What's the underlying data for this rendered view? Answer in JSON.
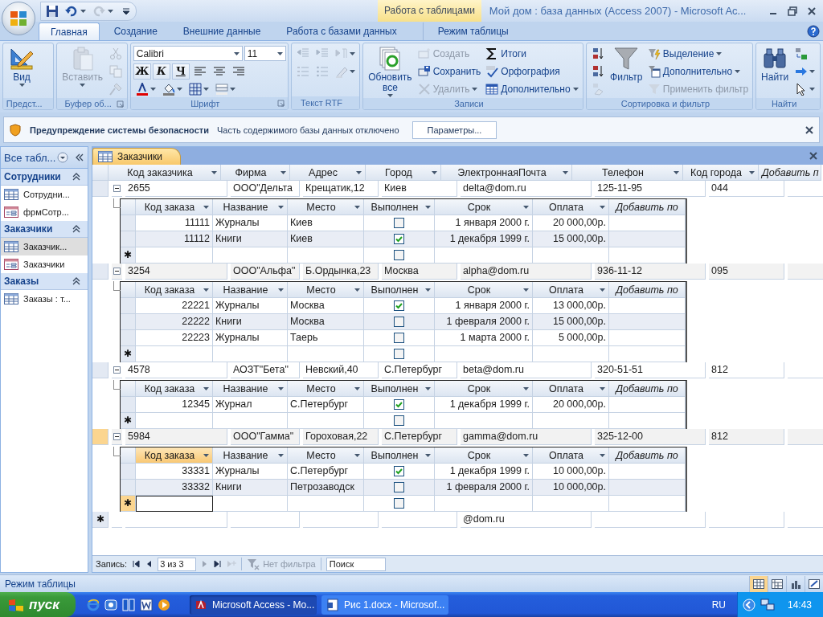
{
  "window": {
    "title": "Мой дом : база данных (Access 2007) - Microsoft Ac...",
    "context_label": "Работа с таблицами"
  },
  "quick_access": [
    {
      "kind": "save",
      "disabled": false
    },
    {
      "kind": "undo",
      "disabled": false
    },
    {
      "kind": "redo",
      "disabled": true
    }
  ],
  "ribbon_tabs": [
    {
      "label": "Главная",
      "selected": true,
      "kind": "main"
    },
    {
      "label": "Создание",
      "selected": false,
      "kind": "main"
    },
    {
      "label": "Внешние данные",
      "selected": false,
      "kind": "main"
    },
    {
      "label": "Работа с базами данных",
      "selected": false,
      "kind": "main"
    },
    {
      "label": "Режим таблицы",
      "selected": false,
      "kind": "context"
    }
  ],
  "ribbon_groups": [
    {
      "label": "Предст...",
      "launcher": false,
      "parts": [
        {
          "kind": "large",
          "label": "Вид",
          "caret": true,
          "disabled": false
        }
      ]
    },
    {
      "label": "Буфер об...",
      "launcher": true,
      "parts": [
        {
          "kind": "large",
          "label": "Вставить",
          "caret": true,
          "disabled": true
        },
        {
          "kind": "stack",
          "items": [
            {
              "kind": "icon",
              "disabled": true
            },
            {
              "kind": "icon",
              "disabled": true
            },
            {
              "kind": "icon",
              "disabled": true
            }
          ]
        }
      ]
    },
    {
      "label": "Шрифт",
      "launcher": true,
      "parts": [
        {
          "kind": "lines",
          "lines": [
            {
              "items": [
                {
                  "kind": "field",
                  "label": "Calibri",
                  "wide": true
                },
                {
                  "kind": "field",
                  "label": "11",
                  "wide": false
                }
              ]
            },
            {
              "items": [
                {
                  "kind": "text",
                  "label": "Ж"
                },
                {
                  "kind": "text",
                  "label": "К"
                },
                {
                  "kind": "text",
                  "label": "Ч"
                },
                {
                  "kind": "icon",
                  "disabled": false
                },
                {
                  "kind": "icon",
                  "disabled": false
                },
                {
                  "kind": "icon",
                  "disabled": false
                }
              ]
            },
            {
              "items": [
                {
                  "kind": "icon",
                  "disabled": false,
                  "caret": true
                },
                {
                  "kind": "icon",
                  "disabled": false,
                  "caret": true
                },
                {
                  "kind": "icon",
                  "disabled": false,
                  "caret": true
                },
                {
                  "kind": "icon",
                  "disabled": false,
                  "caret": true
                }
              ]
            }
          ]
        }
      ]
    },
    {
      "label": "Текст RTF",
      "launcher": false,
      "parts": [
        {
          "kind": "lines",
          "lines": [
            {
              "items": [
                {
                  "kind": "icon",
                  "disabled": true
                },
                {
                  "kind": "icon",
                  "disabled": true
                },
                {
                  "kind": "icon",
                  "disabled": true,
                  "caret": true
                }
              ]
            },
            {
              "items": [
                {
                  "kind": "icon",
                  "disabled": true
                },
                {
                  "kind": "icon",
                  "disabled": true
                },
                {
                  "kind": "icon",
                  "disabled": true,
                  "caret": true
                }
              ]
            }
          ]
        }
      ]
    },
    {
      "label": "Записи",
      "launcher": false,
      "parts": [
        {
          "kind": "large",
          "label": "Обновить все",
          "caret": true,
          "disabled": false
        },
        {
          "kind": "stack",
          "items": [
            {
              "kind": "small",
              "label": "Создать",
              "disabled": true
            },
            {
              "kind": "small",
              "label": "Сохранить",
              "disabled": false
            },
            {
              "kind": "small",
              "label": "Удалить",
              "disabled": true,
              "caret": true
            }
          ]
        },
        {
          "kind": "stack",
          "items": [
            {
              "kind": "small",
              "label": "Итоги",
              "disabled": false
            },
            {
              "kind": "small",
              "label": "Орфография",
              "disabled": false
            },
            {
              "kind": "small",
              "label": "Дополнительно",
              "disabled": false,
              "caret": true
            }
          ]
        }
      ]
    },
    {
      "label": "Сортировка и фильтр",
      "launcher": false,
      "parts": [
        {
          "kind": "stack",
          "items": [
            {
              "kind": "icon",
              "disabled": false
            },
            {
              "kind": "icon",
              "disabled": false
            },
            {
              "kind": "icon",
              "disabled": true
            }
          ]
        },
        {
          "kind": "large",
          "label": "Фильтр",
          "caret": false,
          "disabled": false
        },
        {
          "kind": "stack",
          "items": [
            {
              "kind": "small",
              "label": "Выделение",
              "disabled": false,
              "caret": true
            },
            {
              "kind": "small",
              "label": "Дополнительно",
              "disabled": false,
              "caret": true
            },
            {
              "kind": "small",
              "label": "Применить фильтр",
              "disabled": true
            }
          ]
        }
      ]
    },
    {
      "label": "Найти",
      "launcher": false,
      "parts": [
        {
          "kind": "large",
          "label": "Найти",
          "caret": false,
          "disabled": false
        },
        {
          "kind": "stack",
          "items": [
            {
              "kind": "icon",
              "disabled": false
            },
            {
              "kind": "icon",
              "disabled": false,
              "caret": true
            },
            {
              "kind": "icon",
              "disabled": false,
              "caret": true
            }
          ]
        }
      ]
    }
  ],
  "security_bar": {
    "title": "Предупреждение системы безопасности",
    "message": "Часть содержимого базы данных отключено",
    "button": "Параметры..."
  },
  "nav_pane": {
    "header": "Все табл...",
    "groups": [
      {
        "label": "Сотрудники",
        "expanded": true,
        "items": [
          {
            "label": "Сотрудни...",
            "kind": "table",
            "selected": false
          },
          {
            "label": "фрмСотр...",
            "kind": "form",
            "selected": false
          }
        ]
      },
      {
        "label": "Заказчики",
        "expanded": true,
        "items": [
          {
            "label": "Заказчик...",
            "kind": "table",
            "selected": true
          },
          {
            "label": "Заказчики",
            "kind": "form",
            "selected": false
          }
        ]
      },
      {
        "label": "Заказы",
        "expanded": true,
        "items": [
          {
            "label": "Заказы : т...",
            "kind": "table",
            "selected": false
          }
        ]
      }
    ]
  },
  "document_tab": {
    "label": "Заказчики",
    "selected": true
  },
  "table": {
    "columns": [
      {
        "label": "Код заказчика",
        "kind": "text"
      },
      {
        "label": "Фирма",
        "kind": "text"
      },
      {
        "label": "Адрес",
        "kind": "text"
      },
      {
        "label": "Город",
        "kind": "text"
      },
      {
        "label": "ЭлектроннаяПочта",
        "kind": "text"
      },
      {
        "label": "Телефон",
        "kind": "text"
      },
      {
        "label": "Код города",
        "kind": "text"
      },
      {
        "label": "Добавить п",
        "kind": "add"
      }
    ],
    "rows": [
      {
        "values": [
          "2655",
          "ООО\"Дельта",
          "Крещатик,12",
          "Киев",
          "delta@dom.ru",
          "125-11-95",
          "044"
        ],
        "selected": false,
        "expanded": true,
        "orders": {
          "columns": [
            {
              "label": "Код заказа",
              "kind": "number"
            },
            {
              "label": "Название",
              "kind": "text"
            },
            {
              "label": "Место",
              "kind": "text"
            },
            {
              "label": "Выполнен",
              "kind": "check"
            },
            {
              "label": "Срок",
              "kind": "date"
            },
            {
              "label": "Оплата",
              "kind": "money"
            },
            {
              "label": "Добавить по",
              "kind": "add"
            }
          ],
          "rows": [
            {
              "values": [
                "11111",
                "Журналы",
                "Киев",
                "1 января 2000 г.",
                "20 000,00р."
              ],
              "done": false,
              "selected": false
            },
            {
              "values": [
                "11112",
                "Книги",
                "Киев",
                "1 декабря 1999 г.",
                "15 000,00р."
              ],
              "done": true,
              "selected": false
            }
          ],
          "new_row": {
            "marker": "✱",
            "done": false,
            "selected": false
          }
        }
      },
      {
        "values": [
          "3254",
          "ООО\"Альфа\"",
          "Б.Ордынка,23",
          "Москва",
          "alpha@dom.ru",
          "936-11-12",
          "095"
        ],
        "selected": false,
        "expanded": true,
        "orders": {
          "columns": [
            {
              "label": "Код заказа",
              "kind": "number"
            },
            {
              "label": "Название",
              "kind": "text"
            },
            {
              "label": "Место",
              "kind": "text"
            },
            {
              "label": "Выполнен",
              "kind": "check"
            },
            {
              "label": "Срок",
              "kind": "date"
            },
            {
              "label": "Оплата",
              "kind": "money"
            },
            {
              "label": "Добавить по",
              "kind": "add"
            }
          ],
          "rows": [
            {
              "values": [
                "22221",
                "Журналы",
                "Москва",
                "1 января 2000 г.",
                "13 000,00р."
              ],
              "done": true,
              "selected": false
            },
            {
              "values": [
                "22222",
                "Книги",
                "Москва",
                "1 февраля 2000 г.",
                "15 000,00р."
              ],
              "done": false,
              "selected": false
            },
            {
              "values": [
                "22223",
                "Журналы",
                "Таерь",
                "1 марта 2000 г.",
                "5 000,00р."
              ],
              "done": false,
              "selected": false
            }
          ],
          "new_row": {
            "marker": "✱",
            "done": false,
            "selected": false
          }
        }
      },
      {
        "values": [
          "4578",
          "АОЗТ\"Бета\"",
          "Невский,40",
          "С.Петербург",
          "beta@dom.ru",
          "320-51-51",
          "812"
        ],
        "selected": false,
        "expanded": true,
        "orders": {
          "columns": [
            {
              "label": "Код заказа",
              "kind": "number"
            },
            {
              "label": "Название",
              "kind": "text"
            },
            {
              "label": "Место",
              "kind": "text"
            },
            {
              "label": "Выполнен",
              "kind": "check"
            },
            {
              "label": "Срок",
              "kind": "date"
            },
            {
              "label": "Оплата",
              "kind": "money"
            },
            {
              "label": "Добавить по",
              "kind": "add"
            }
          ],
          "rows": [
            {
              "values": [
                "12345",
                "Журнал",
                "С.Петербург",
                "1 декабря 1999 г.",
                "20 000,00р."
              ],
              "done": true,
              "selected": false
            }
          ],
          "new_row": {
            "marker": "✱",
            "done": false,
            "selected": false
          }
        }
      },
      {
        "values": [
          "5984",
          "ООО\"Гамма\"",
          "Гороховая,22",
          "С.Петербург",
          "gamma@dom.ru",
          "325-12-00",
          "812"
        ],
        "selected": true,
        "expanded": true,
        "orders": {
          "columns": [
            {
              "label": "Код заказа",
              "kind": "number"
            },
            {
              "label": "Название",
              "kind": "text"
            },
            {
              "label": "Место",
              "kind": "text"
            },
            {
              "label": "Выполнен",
              "kind": "check"
            },
            {
              "label": "Срок",
              "kind": "date"
            },
            {
              "label": "Оплата",
              "kind": "money"
            },
            {
              "label": "Добавить по",
              "kind": "add"
            }
          ],
          "rows": [
            {
              "values": [
                "33331",
                "Журналы",
                "С.Петербург",
                "1 декабря 1999 г.",
                "10 000,00р."
              ],
              "done": true,
              "selected": false
            },
            {
              "values": [
                "33332",
                "Книги",
                "Петрозаводск",
                "1 февраля 2000 г.",
                "10 000,00р."
              ],
              "done": false,
              "selected": false
            }
          ],
          "new_row": {
            "marker": "✱",
            "done": false,
            "selected": true
          }
        }
      }
    ],
    "new_row": {
      "marker": "✱",
      "email": "@dom.ru",
      "selected": false
    }
  },
  "record_nav": {
    "label": "Запись:",
    "position": "3 из 3",
    "filter": "Нет фильтра",
    "filter_disabled": true,
    "search_placeholder": "Поиск"
  },
  "status_bar": {
    "text": "Режим таблицы",
    "views": [
      {
        "selected": true
      },
      {
        "selected": false
      },
      {
        "selected": false
      },
      {
        "selected": false
      }
    ]
  },
  "taskbar": {
    "start": "пуск",
    "tasks": [
      {
        "label": "Microsoft Access - Mo...",
        "kind": "access",
        "selected": true
      },
      {
        "label": "Рис 1.docx - Microsof...",
        "kind": "word",
        "selected": false
      }
    ],
    "language": "RU",
    "clock": "14:43"
  }
}
